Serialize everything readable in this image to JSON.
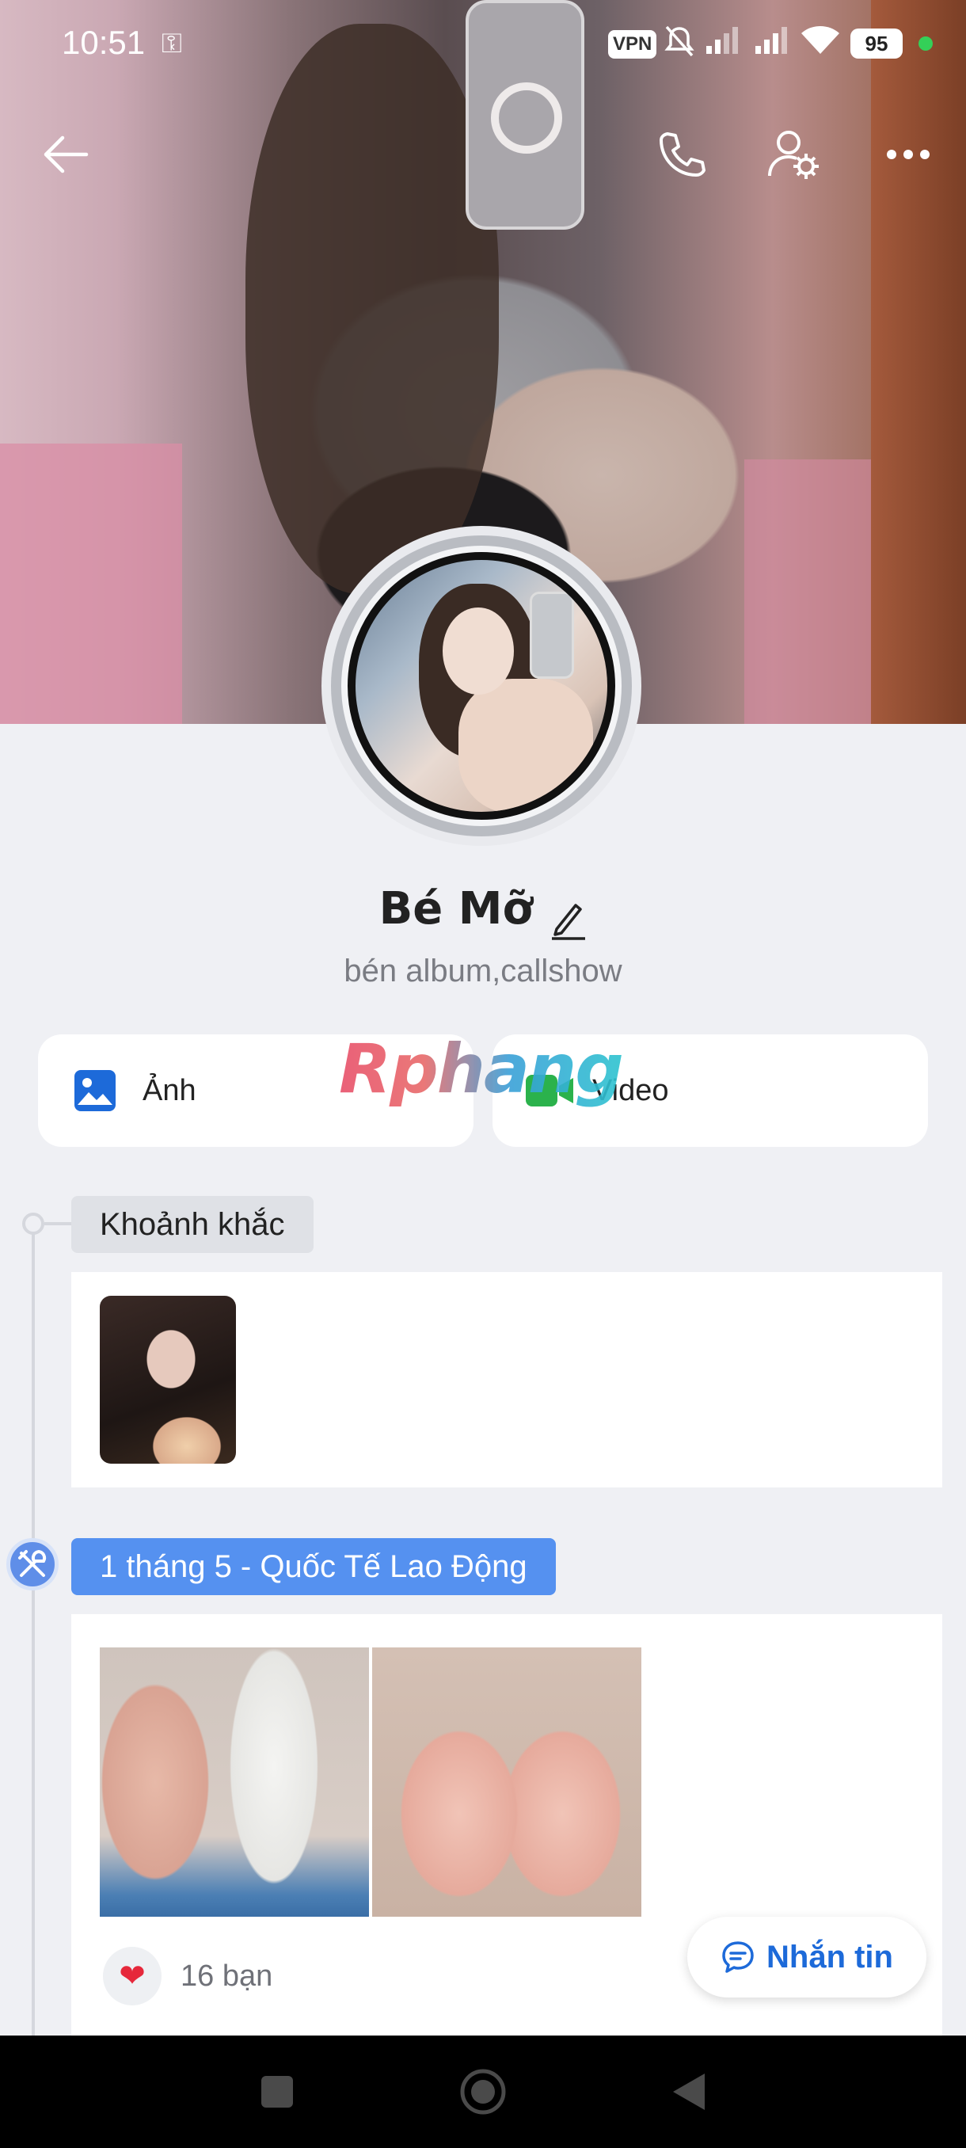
{
  "status_bar": {
    "time": "10:51",
    "vpn": "VPN",
    "battery": "95",
    "icons": [
      "key-icon",
      "vpn-icon",
      "mute-icon",
      "signal-icon",
      "signal-icon",
      "wifi-icon",
      "battery-icon"
    ]
  },
  "header": {
    "back_icon": "arrow-left-icon",
    "call_icon": "phone-icon",
    "settings_icon": "user-settings-icon",
    "more_icon": "more-horizontal-icon"
  },
  "profile": {
    "name": "Bé Mỡ",
    "bio": "bén album,callshow",
    "edit_icon": "pencil-icon"
  },
  "media_cards": [
    {
      "label": "Ảnh",
      "icon": "image-icon",
      "color": "#1d6ad9"
    },
    {
      "label": "Video",
      "icon": "video-camera-icon",
      "color": "#2bb24c"
    }
  ],
  "watermark": "Rphang",
  "timeline": {
    "moments_label": "Khoảnh khắc",
    "event_label": "1 tháng 5 - Quốc Tế Lao Động",
    "event_icon": "tools-icon",
    "likes": {
      "icon": "heart-icon",
      "text": "16 bạn"
    }
  },
  "message_button": {
    "label": "Nhắn tin",
    "icon": "chat-bubble-icon"
  },
  "colors": {
    "accent": "#1d6ad9",
    "event_tag": "#5591f0",
    "background": "#eff0f4"
  }
}
